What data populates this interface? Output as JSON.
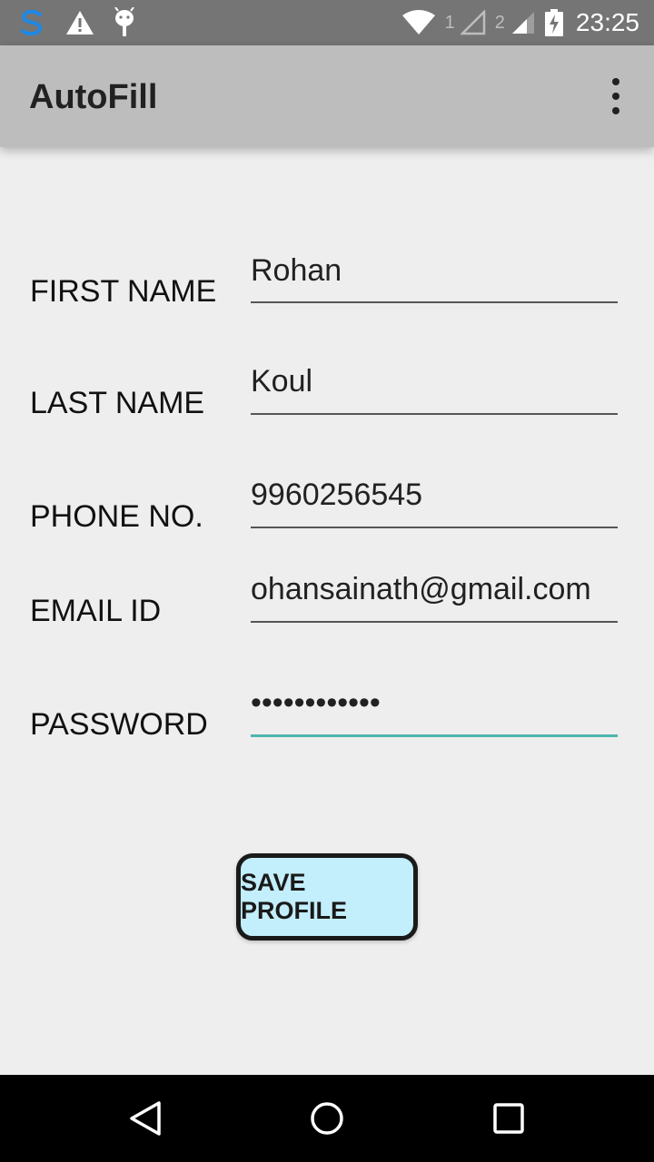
{
  "status_bar": {
    "time": "23:25",
    "sim1_label": "1",
    "sim2_label": "2",
    "icons": [
      "s-app-icon",
      "warning-icon",
      "android-debug-icon",
      "wifi-icon",
      "signal-sim1-icon",
      "signal-sim2-icon",
      "battery-charging-icon"
    ]
  },
  "app_bar": {
    "title": "AutoFill",
    "menu_icon": "overflow-menu-icon"
  },
  "form": {
    "first_name": {
      "label": "FIRST NAME",
      "value": "Rohan"
    },
    "last_name": {
      "label": "LAST NAME",
      "value": "Koul"
    },
    "phone": {
      "label": "PHONE NO.",
      "value": "9960256545"
    },
    "email": {
      "label": "EMAIL ID",
      "value": "ohansainath@gmail.com"
    },
    "password": {
      "label": "PASSWORD",
      "value": "••••••••••••"
    }
  },
  "save_button": {
    "label": "SAVE PROFILE"
  },
  "nav_bar": {
    "icons": [
      "back-icon",
      "home-icon",
      "recents-icon"
    ]
  },
  "colors": {
    "status_bar": "#757575",
    "app_bar": "#bdbdbd",
    "background": "#eeeeee",
    "button_fill": "#c3eefb",
    "active_underline": "#4db6ac"
  }
}
